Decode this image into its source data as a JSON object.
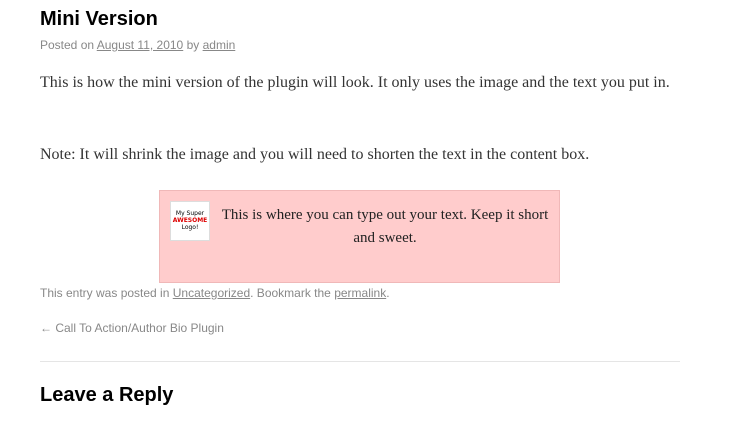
{
  "post": {
    "title": "Mini Version",
    "meta": {
      "posted_on": "Posted on",
      "date": "August 11, 2010",
      "by": "by",
      "author": "admin"
    },
    "paragraphs": [
      "This is how the mini version of the plugin will look. It only uses the image and the text you put in.",
      "Note: It will shrink the image and you will need to shorten the text in the content box."
    ],
    "cta_box": {
      "background": "#ffcccc",
      "logo_line1": "My Super",
      "logo_line2": "AWESOME",
      "logo_line3": "Logo!",
      "text": "This is where you can type out your text. Keep it short and sweet."
    },
    "utility": {
      "prefix": "This entry was posted in",
      "category": "Uncategorized",
      "middle": ". Bookmark the",
      "permalink": "permalink",
      "suffix": "."
    }
  },
  "navigation": {
    "previous": "← Call To Action/Author Bio Plugin"
  },
  "comments": {
    "reply_title": "Leave a Reply"
  }
}
